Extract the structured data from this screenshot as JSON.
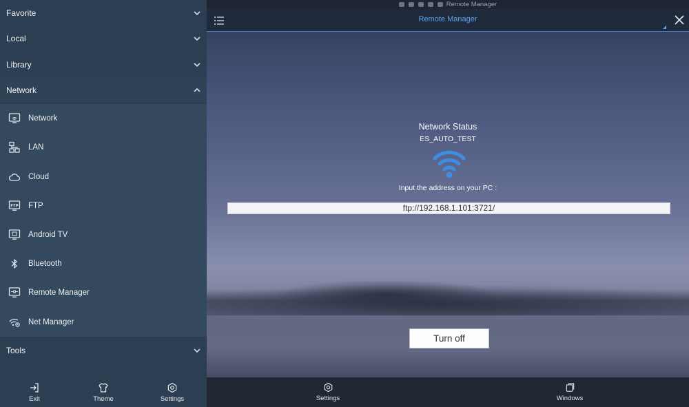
{
  "sidebar": {
    "sections": [
      {
        "label": "Favorite",
        "icon": "chevron-down-icon"
      },
      {
        "label": "Local",
        "icon": "chevron-down-icon"
      },
      {
        "label": "Library",
        "icon": "chevron-down-icon"
      },
      {
        "label": "Network",
        "icon": "chevron-up-icon"
      },
      {
        "label": "Tools",
        "icon": "chevron-down-icon"
      }
    ],
    "network_items": [
      {
        "label": "Network",
        "icon": "network-icon"
      },
      {
        "label": "LAN",
        "icon": "lan-icon"
      },
      {
        "label": "Cloud",
        "icon": "cloud-icon"
      },
      {
        "label": "FTP",
        "icon": "ftp-icon"
      },
      {
        "label": "Android TV",
        "icon": "android-tv-icon"
      },
      {
        "label": "Bluetooth",
        "icon": "bluetooth-icon"
      },
      {
        "label": "Remote Manager",
        "icon": "remote-manager-icon"
      },
      {
        "label": "Net Manager",
        "icon": "net-manager-icon"
      }
    ],
    "footer": [
      {
        "label": "Exit",
        "icon": "exit-icon"
      },
      {
        "label": "Theme",
        "icon": "theme-icon"
      },
      {
        "label": "Settings",
        "icon": "settings-icon"
      }
    ]
  },
  "statusbar": {
    "title": "Remote Manager"
  },
  "topbar": {
    "title": "Remote Manager"
  },
  "main": {
    "status_title": "Network Status",
    "ssid": "ES_AUTO_TEST",
    "address_hint": "Input the address on your PC :",
    "address": "ftp://192.168.1.101:3721/",
    "turn_off_label": "Turn off"
  },
  "bottombar": [
    {
      "label": "Settings",
      "icon": "settings-icon"
    },
    {
      "label": "Windows",
      "icon": "windows-icon"
    }
  ],
  "colors": {
    "accent": "#5aa6ee",
    "sidebar_bg": "#2c3e52",
    "subnav_bg": "#34495e",
    "wifi_blue": "#3d8ee0"
  }
}
